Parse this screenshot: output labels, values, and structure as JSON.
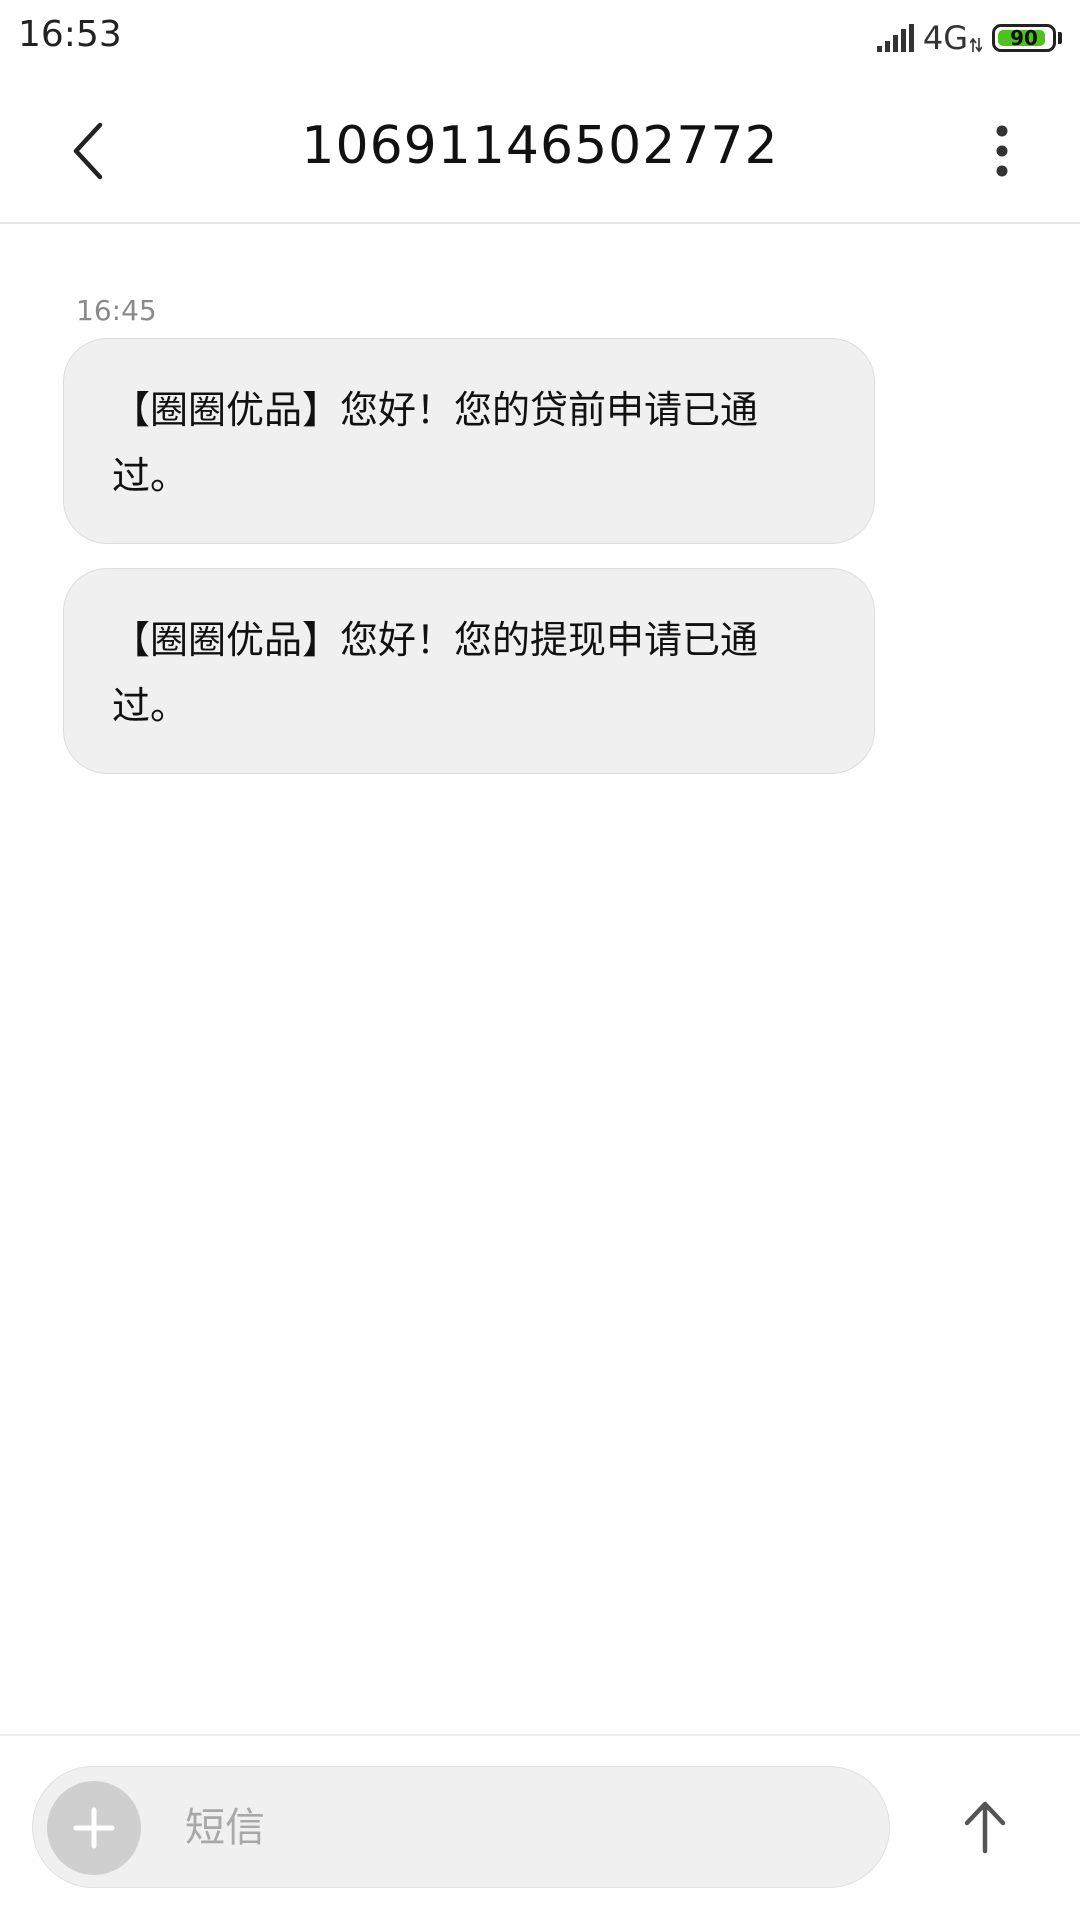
{
  "status_bar": {
    "time": "16:53",
    "network": "4G",
    "battery_level": "90",
    "battery_fraction": 0.9,
    "icons": [
      "signal-icon",
      "data-arrows-icon",
      "battery-icon"
    ],
    "battery_color": "#4fc21f"
  },
  "header": {
    "title": "10691146502772",
    "icons": [
      "back-arrow-icon",
      "more-vertical-icon"
    ]
  },
  "conversation": {
    "timestamp": "16:45",
    "messages": [
      {
        "text": "【圈圈优品】您好！您的贷前申请已通过。"
      },
      {
        "text": "【圈圈优品】您好！您的提现申请已通过。"
      }
    ],
    "bubble_color": "#f0f0f0"
  },
  "compose": {
    "placeholder": "短信",
    "value": "",
    "icons": [
      "plus-icon",
      "send-arrow-up-icon"
    ]
  }
}
